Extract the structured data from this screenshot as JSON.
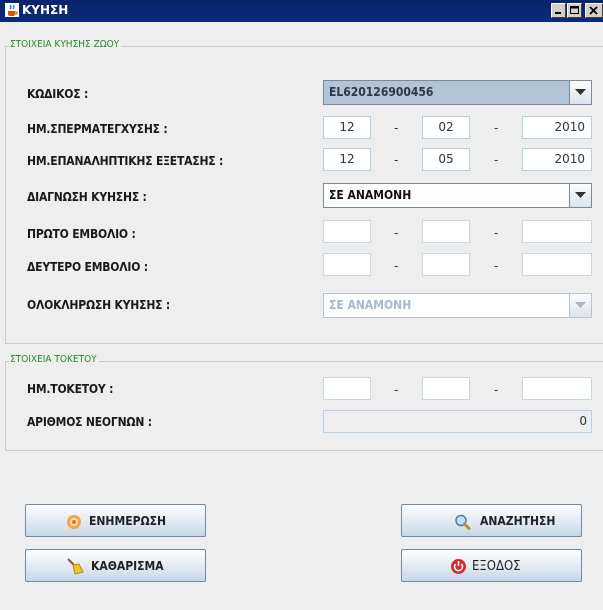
{
  "window": {
    "title": "ΚΥΗΣΗ",
    "app_icon": "java-cup-icon"
  },
  "titlebar_buttons": {
    "minimize": "minimize-icon",
    "maximize": "maximize-icon",
    "close": "close-icon"
  },
  "section_pregnancy": {
    "title": "ΣΤΟΙΧΕΙΑ ΚΥΗΣΗΣ ΖΩΟΥ",
    "code_label": "ΚΩΔΙΚΟΣ :",
    "code_value": "EL620126900456",
    "insemination_label": "ΗΜ.ΣΠΕΡΜΑΤΕΓΧΥΣΗΣ :",
    "insemination_date": {
      "day": "12",
      "month": "02",
      "year": "2010"
    },
    "reexam_label": "ΗΜ.ΕΠΑΝΑΛΗΠΤΙΚΗΣ ΕΞΕΤΑΣΗΣ :",
    "reexam_date": {
      "day": "12",
      "month": "05",
      "year": "2010"
    },
    "diagnosis_label": "ΔΙΑΓΝΩΣΗ ΚΥΗΣΗΣ :",
    "diagnosis_value": "ΣΕ ΑΝΑΜΟΝΗ",
    "vaccine1_label": "ΠΡΩΤΟ ΕΜΒΟΛΙΟ :",
    "vaccine1_date": {
      "day": "",
      "month": "",
      "year": ""
    },
    "vaccine2_label": "ΔΕΥΤΕΡΟ ΕΜΒΟΛΙΟ :",
    "vaccine2_date": {
      "day": "",
      "month": "",
      "year": ""
    },
    "completion_label": "ΟΛΟΚΛΗΡΩΣΗ ΚΥΗΣΗΣ :",
    "completion_value": "ΣΕ ΑΝΑΜΟΝΗ"
  },
  "section_birth": {
    "title": "ΣΤΟΙΧΕΙΑ ΤΟΚΕΤΟΥ",
    "birth_date_label": "ΗΜ.ΤΟΚΕΤΟΥ :",
    "birth_date": {
      "day": "",
      "month": "",
      "year": ""
    },
    "newborns_label": "ΑΡΙΘΜΟΣ ΝΕΟΓΝΩΝ :",
    "newborns_value": "0"
  },
  "separator": "-",
  "buttons": {
    "update": "ΕΝΗΜΕΡΩΣΗ",
    "search": "ΑΝΑΖΗΤΗΣΗ",
    "clear": "ΚΑΘΑΡΙΣΜΑ",
    "exit": "ΕΞΟΔΟΣ"
  },
  "colors": {
    "titlebar": "#0a246a",
    "section_title": "#228b22",
    "selected_combo": "#b3c4d8",
    "field_border": "#b8cfe5"
  }
}
